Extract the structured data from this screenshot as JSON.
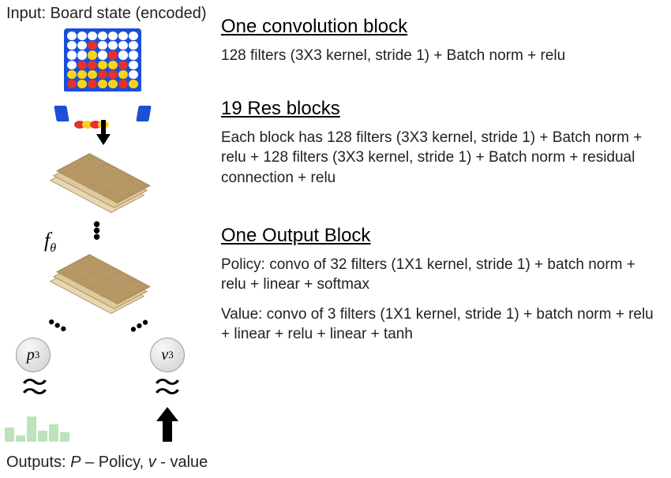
{
  "labels": {
    "input": "Input: Board state (encoded)",
    "output_prefix": "Outputs: ",
    "output_p": "P",
    "output_p_desc": " – Policy, ",
    "output_v": "v",
    "output_v_desc": " - value",
    "f": "f",
    "theta": "θ",
    "p_node": "p",
    "p_sub": "3",
    "v_node": "v",
    "v_sub": "3"
  },
  "sections": {
    "conv": {
      "title": "One convolution block",
      "desc": "128 filters (3X3 kernel, stride 1) + Batch norm + relu"
    },
    "res": {
      "title": "19 Res blocks",
      "desc": "Each block has 128 filters (3X3 kernel, stride 1) + Batch norm + relu + 128 filters (3X3 kernel, stride 1) + Batch norm + residual connection + relu"
    },
    "out": {
      "title": "One Output Block",
      "policy": "Policy: convo of 32 filters (1X1 kernel, stride 1) + batch norm + relu + linear + softmax",
      "value": "Value: convo of 3 filters (1X1 kernel, stride 1) + batch norm + relu + linear + relu + linear + tanh"
    }
  },
  "diagram": {
    "connect4_pattern": [
      [
        "",
        "",
        "",
        "",
        "",
        "",
        ""
      ],
      [
        "",
        "",
        "r",
        "",
        "",
        "",
        ""
      ],
      [
        "",
        "",
        "y",
        "",
        "r",
        "",
        ""
      ],
      [
        "",
        "r",
        "r",
        "y",
        "y",
        "r",
        ""
      ],
      [
        "y",
        "y",
        "y",
        "r",
        "r",
        "y",
        ""
      ],
      [
        "r",
        "y",
        "r",
        "y",
        "y",
        "r",
        "y"
      ]
    ],
    "histogram": [
      18,
      8,
      32,
      14,
      22,
      12
    ]
  }
}
